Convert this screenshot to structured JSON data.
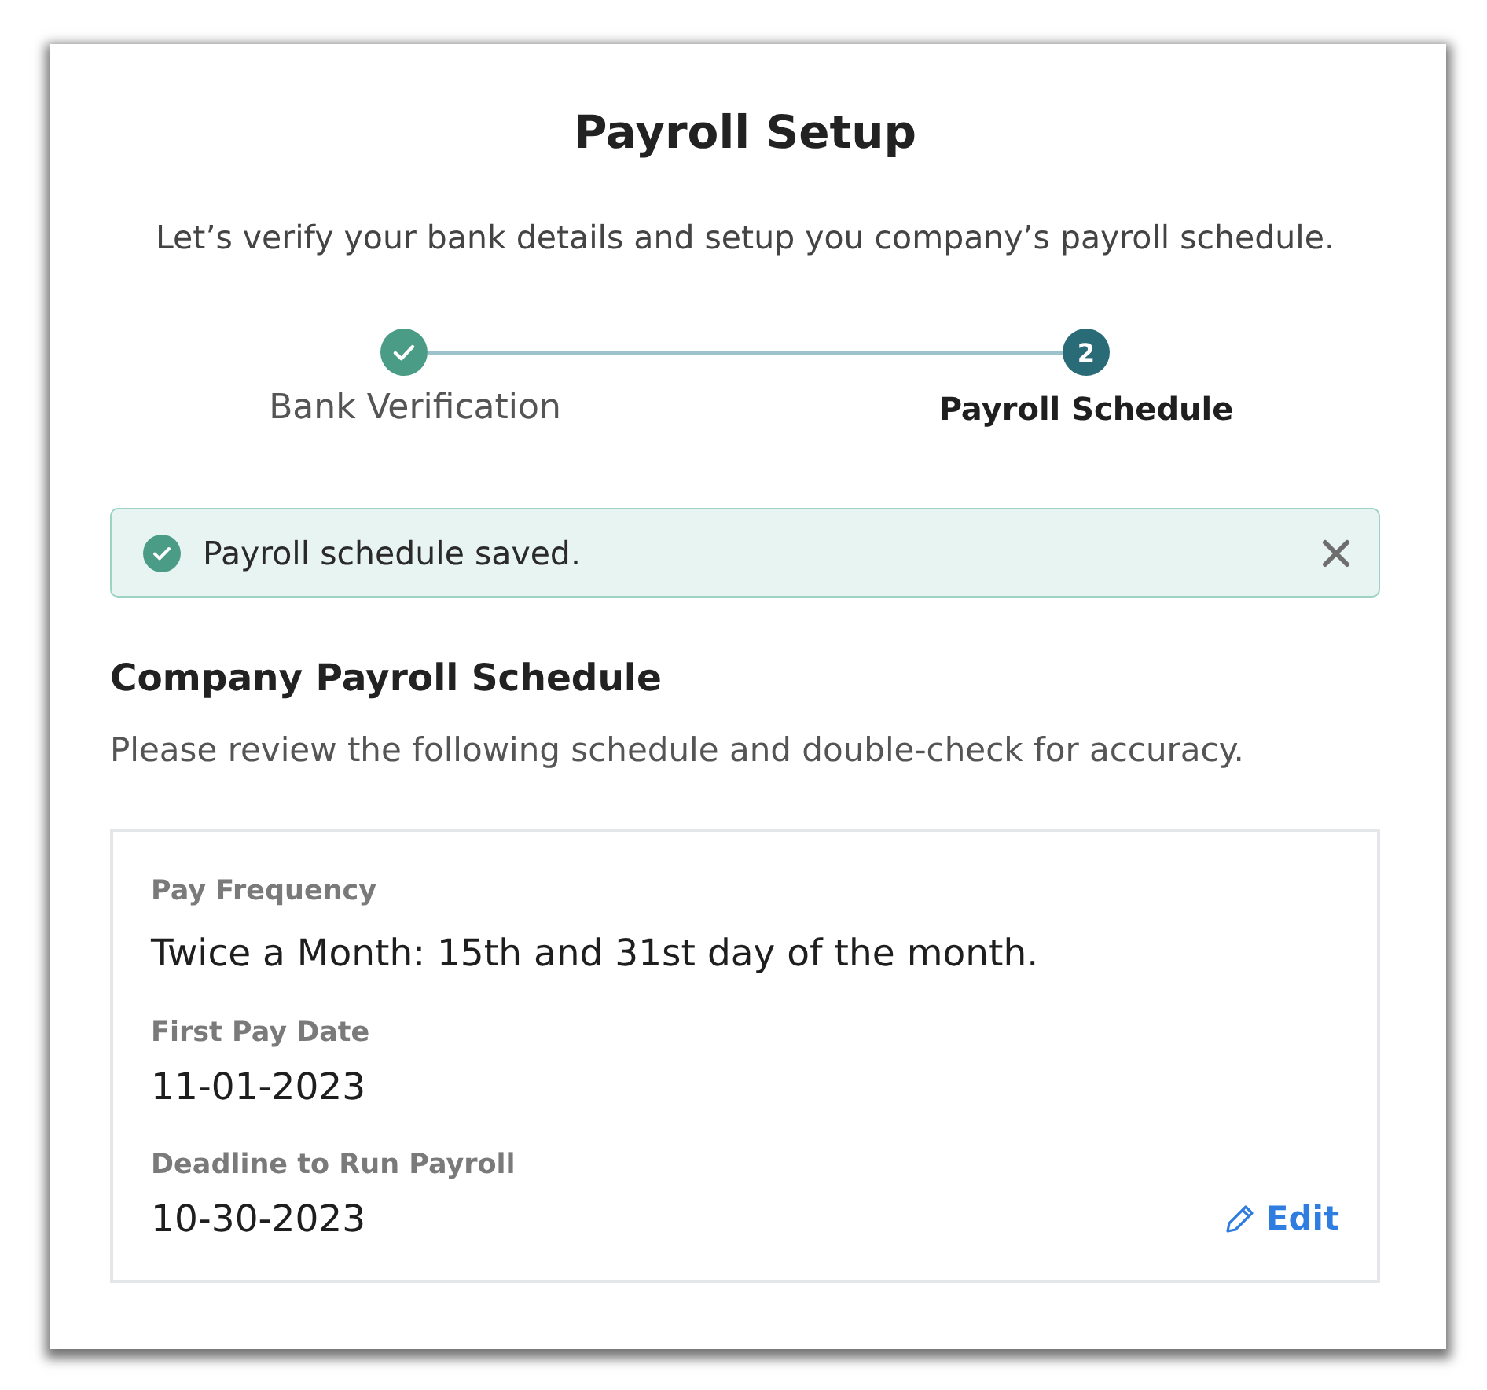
{
  "header": {
    "title": "Payroll Setup",
    "subtitle": "Let’s verify your bank details and setup you company’s payroll schedule."
  },
  "stepper": {
    "steps": [
      {
        "label": "Bank Verification",
        "completed": true,
        "selected": false
      },
      {
        "label": "Payroll Schedule",
        "completed": false,
        "selected": true,
        "number": "2"
      }
    ]
  },
  "alert": {
    "kind": "success",
    "message": "Payroll schedule saved.",
    "dismissible": true
  },
  "schedule": {
    "title": "Company Payroll Schedule",
    "description": "Please review the following schedule and double-check for accuracy.",
    "fields": [
      {
        "label": "Pay Frequency",
        "value": "Twice a Month: 15th and 31st day of the month."
      },
      {
        "label": "First Pay Date",
        "value": "11-01-2023"
      },
      {
        "label": "Deadline to Run Payroll",
        "value": "10-30-2023"
      }
    ],
    "edit_link": "Edit"
  }
}
